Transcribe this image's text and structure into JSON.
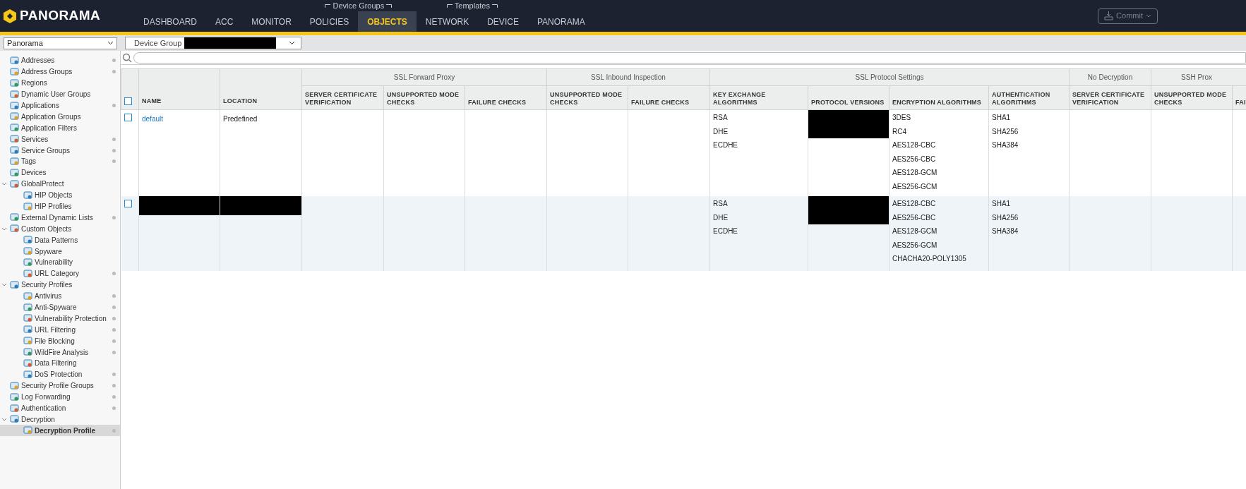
{
  "brand": "PANORAMA",
  "nav": [
    {
      "label": "DASHBOARD",
      "selected": false
    },
    {
      "label": "ACC",
      "selected": false
    },
    {
      "label": "MONITOR",
      "selected": false
    },
    {
      "group": "Device Groups",
      "tabs": [
        {
          "label": "POLICIES",
          "selected": false
        },
        {
          "label": "OBJECTS",
          "selected": true
        }
      ]
    },
    {
      "group": "Templates",
      "tabs": [
        {
          "label": "NETWORK",
          "selected": false
        },
        {
          "label": "DEVICE",
          "selected": false
        }
      ]
    },
    {
      "label": "PANORAMA",
      "selected": false
    }
  ],
  "commit": {
    "label": "Commit",
    "disabled": true
  },
  "context_select": {
    "value": "Panorama"
  },
  "device_group": {
    "label": "Device Group",
    "redacted": true
  },
  "sidebar": {
    "items": [
      {
        "label": "Addresses",
        "dot": true,
        "selected": false
      },
      {
        "label": "Address Groups",
        "dot": true,
        "selected": false
      },
      {
        "label": "Regions",
        "dot": false,
        "selected": false
      },
      {
        "label": "Dynamic User Groups",
        "dot": false,
        "selected": false
      },
      {
        "label": "Applications",
        "dot": true,
        "selected": false
      },
      {
        "label": "Application Groups",
        "dot": false,
        "selected": false
      },
      {
        "label": "Application Filters",
        "dot": false,
        "selected": false
      },
      {
        "label": "Services",
        "dot": true,
        "selected": false
      },
      {
        "label": "Service Groups",
        "dot": true,
        "selected": false
      },
      {
        "label": "Tags",
        "dot": true,
        "selected": false
      },
      {
        "label": "Devices",
        "dot": false,
        "selected": false
      },
      {
        "label": "GlobalProtect",
        "dot": false,
        "selected": false,
        "expanded": true,
        "children": [
          {
            "label": "HIP Objects",
            "dot": false,
            "selected": false
          },
          {
            "label": "HIP Profiles",
            "dot": false,
            "selected": false
          }
        ]
      },
      {
        "label": "External Dynamic Lists",
        "dot": true,
        "selected": false
      },
      {
        "label": "Custom Objects",
        "dot": false,
        "selected": false,
        "expanded": true,
        "children": [
          {
            "label": "Data Patterns",
            "dot": false,
            "selected": false
          },
          {
            "label": "Spyware",
            "dot": false,
            "selected": false
          },
          {
            "label": "Vulnerability",
            "dot": false,
            "selected": false
          },
          {
            "label": "URL Category",
            "dot": true,
            "selected": false
          }
        ]
      },
      {
        "label": "Security Profiles",
        "dot": false,
        "selected": false,
        "expanded": true,
        "children": [
          {
            "label": "Antivirus",
            "dot": true,
            "selected": false
          },
          {
            "label": "Anti-Spyware",
            "dot": true,
            "selected": false
          },
          {
            "label": "Vulnerability Protection",
            "dot": true,
            "selected": false
          },
          {
            "label": "URL Filtering",
            "dot": true,
            "selected": false
          },
          {
            "label": "File Blocking",
            "dot": true,
            "selected": false
          },
          {
            "label": "WildFire Analysis",
            "dot": true,
            "selected": false
          },
          {
            "label": "Data Filtering",
            "dot": false,
            "selected": false
          },
          {
            "label": "DoS Protection",
            "dot": true,
            "selected": false
          }
        ]
      },
      {
        "label": "Security Profile Groups",
        "dot": true,
        "selected": false
      },
      {
        "label": "Log Forwarding",
        "dot": true,
        "selected": false
      },
      {
        "label": "Authentication",
        "dot": true,
        "selected": false
      },
      {
        "label": "Decryption",
        "dot": false,
        "selected": false,
        "expanded": true,
        "children": [
          {
            "label": "Decryption Profile",
            "dot": true,
            "selected": true
          }
        ]
      }
    ]
  },
  "table": {
    "columns": [
      "NAME",
      "LOCATION"
    ],
    "column_groups": [
      {
        "label": "SSL Forward Proxy",
        "columns": [
          "SERVER CERTIFICATE VERIFICATION",
          "UNSUPPORTED MODE CHECKS",
          "FAILURE CHECKS"
        ]
      },
      {
        "label": "SSL Inbound Inspection",
        "columns": [
          "UNSUPPORTED MODE CHECKS",
          "FAILURE CHECKS"
        ]
      },
      {
        "label": "SSL Protocol Settings",
        "columns": [
          "KEY EXCHANGE ALGORITHMS",
          "PROTOCOL VERSIONS",
          "ENCRYPTION ALGORITHMS",
          "AUTHENTICATION ALGORITHMS"
        ]
      },
      {
        "label": "No Decryption",
        "columns": [
          "SERVER CERTIFICATE VERIFICATION"
        ]
      },
      {
        "label": "SSH Prox",
        "columns": [
          "UNSUPPORTED MODE CHECKS",
          "FAI"
        ]
      }
    ],
    "header_checked": false,
    "rows": [
      {
        "checked": false,
        "name": "default",
        "location": "Predefined",
        "name_redacted": false,
        "key_exchange": [
          "RSA",
          "DHE",
          "ECDHE"
        ],
        "protocol_redacted": true,
        "encryption": [
          "3DES",
          "RC4",
          "AES128-CBC",
          "AES256-CBC",
          "AES128-GCM",
          "AES256-GCM"
        ],
        "authentication": [
          "SHA1",
          "SHA256",
          "SHA384"
        ]
      },
      {
        "checked": false,
        "name_redacted": true,
        "key_exchange": [
          "RSA",
          "DHE",
          "ECDHE"
        ],
        "protocol_redacted": true,
        "encryption": [
          "AES128-CBC",
          "AES256-CBC",
          "AES128-GCM",
          "AES256-GCM",
          "CHACHA20-POLY1305"
        ],
        "authentication": [
          "SHA1",
          "SHA256",
          "SHA384"
        ]
      }
    ]
  }
}
